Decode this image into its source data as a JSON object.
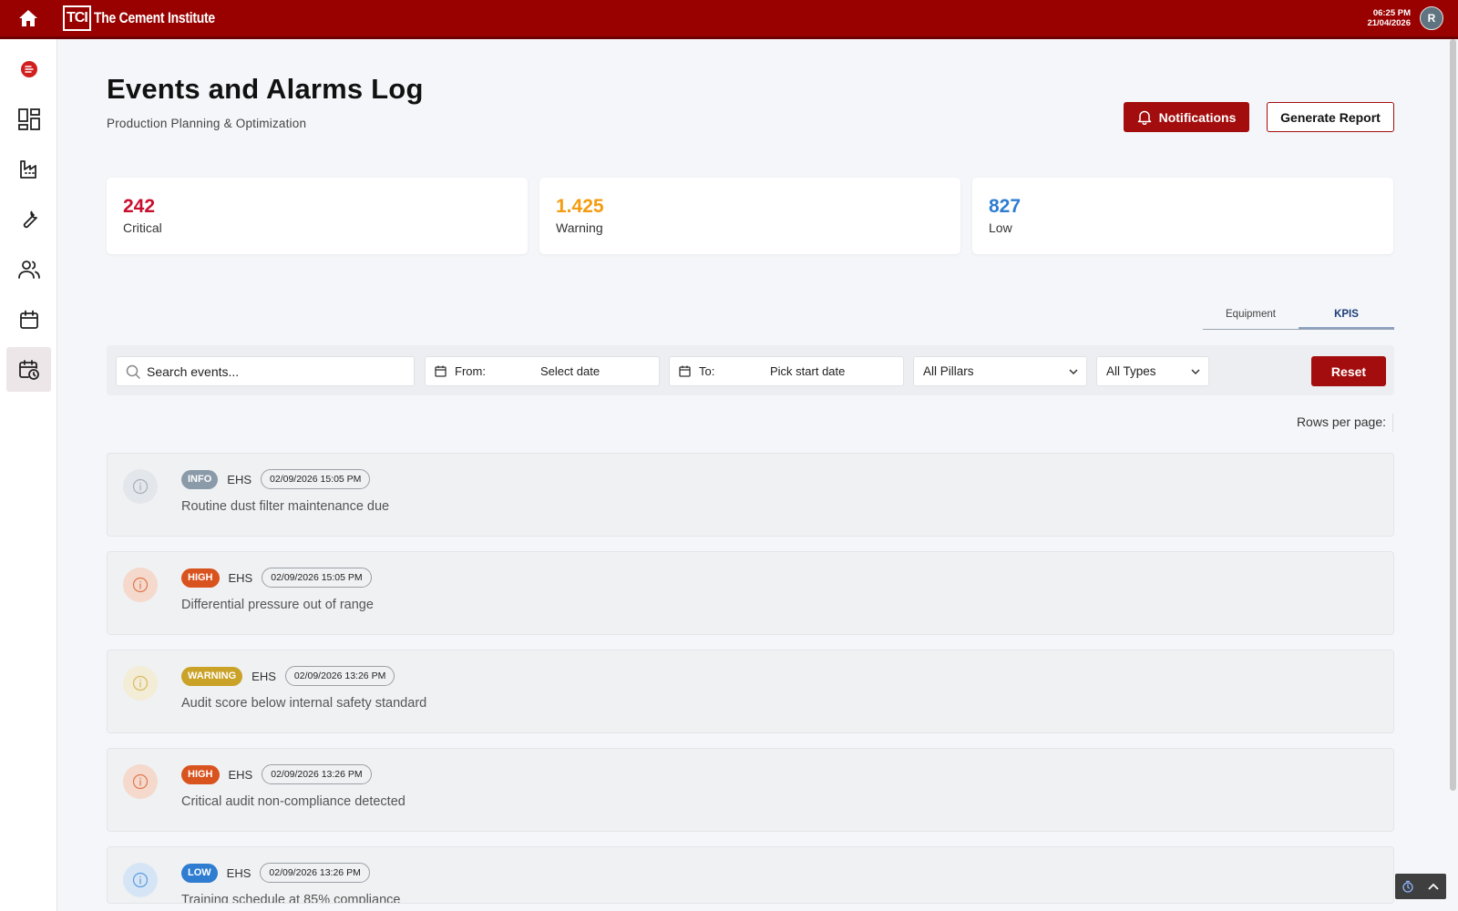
{
  "header": {
    "logo_mark": "TCI",
    "logo_text": "The Cement Institute",
    "time": "06:25 PM",
    "date": "21/04/2026",
    "avatar_initial": "R"
  },
  "sidebar": {
    "items": [
      {
        "name": "menu-toggle",
        "icon": "menu-circle-icon"
      },
      {
        "name": "dashboard",
        "icon": "dashboard-icon"
      },
      {
        "name": "factory",
        "icon": "factory-icon"
      },
      {
        "name": "maintenance",
        "icon": "wrench-icon"
      },
      {
        "name": "users",
        "icon": "users-icon"
      },
      {
        "name": "calendar",
        "icon": "calendar-icon"
      },
      {
        "name": "events-log",
        "icon": "calendar-clock-icon",
        "active": true
      }
    ]
  },
  "page": {
    "title": "Events and Alarms Log",
    "subtitle": "Production Planning & Optimization",
    "notifications_label": "Notifications",
    "report_label": "Generate Report"
  },
  "stats": [
    {
      "value": "242",
      "label": "Critical",
      "color": "#c8102e"
    },
    {
      "value": "1.425",
      "label": "Warning",
      "color": "#f39c12"
    },
    {
      "value": "827",
      "label": "Low",
      "color": "#2f7dd1"
    }
  ],
  "tabs": [
    {
      "label": "Equipment",
      "active": false
    },
    {
      "label": "KPIS",
      "active": true
    }
  ],
  "filters": {
    "search_placeholder": "Search events...",
    "from_label": "From:",
    "from_value": "Select date",
    "to_label": "To:",
    "to_value": "Pick start date",
    "pillars_value": "All Pillars",
    "types_value": "All Types",
    "reset_label": "Reset"
  },
  "rows_per_page_label": "Rows per page:",
  "events": [
    {
      "severity": "INFO",
      "severity_color": "#8a9aa8",
      "icon_bg": "#e3e6ea",
      "icon_color": "#a5b0bb",
      "pillar": "EHS",
      "timestamp": "02/09/2026 15:05 PM",
      "description": "Routine dust filter maintenance due"
    },
    {
      "severity": "HIGH",
      "severity_color": "#d9531e",
      "icon_bg": "#f4d9cc",
      "icon_color": "#e0784c",
      "pillar": "EHS",
      "timestamp": "02/09/2026 15:05 PM",
      "description": "Differential pressure out of range"
    },
    {
      "severity": "WARNING",
      "severity_color": "#c9a227",
      "icon_bg": "#f3ecd6",
      "icon_color": "#d8bb5e",
      "pillar": "EHS",
      "timestamp": "02/09/2026 13:26 PM",
      "description": "Audit score below internal safety standard"
    },
    {
      "severity": "HIGH",
      "severity_color": "#d9531e",
      "icon_bg": "#f4d9cc",
      "icon_color": "#e0784c",
      "pillar": "EHS",
      "timestamp": "02/09/2026 13:26 PM",
      "description": "Critical audit non-compliance detected"
    },
    {
      "severity": "LOW",
      "severity_color": "#2f7dd1",
      "icon_bg": "#d6e5f5",
      "icon_color": "#5b9be0",
      "pillar": "EHS",
      "timestamp": "02/09/2026 13:26 PM",
      "description": "Training schedule at 85% compliance"
    }
  ]
}
